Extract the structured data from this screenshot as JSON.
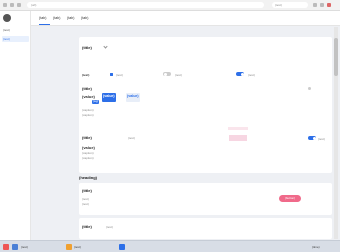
{
  "browser": {
    "url": "(url)",
    "extension_label": "(text)"
  },
  "sidebar": {
    "items": [
      {
        "label": "(text)"
      },
      {
        "label": "(text)"
      }
    ]
  },
  "topnav": {
    "tabs": [
      {
        "label": "(tab)"
      },
      {
        "label": "(tab)"
      },
      {
        "label": "(tab)"
      },
      {
        "label": "(tab)"
      }
    ]
  },
  "account": {
    "title": "(title)"
  },
  "toggles_row": {
    "label": "(text)",
    "option1": "(text)",
    "option2": "(text)",
    "option3": "(text)"
  },
  "stats": {
    "title": "(title)",
    "value1": "(value)",
    "tag": "(tag)",
    "value2": "(value)",
    "value3": "(value)",
    "caption": "(caption)",
    "sub_caption": "(caption)"
  },
  "share": {
    "title": "(title)",
    "note": "(text)",
    "toggle_label": "(text)",
    "percent": "(value)",
    "caption": "(caption)",
    "sub_caption": "(caption)"
  },
  "section_heading": "(heading)",
  "invite": {
    "title": "(title)",
    "desc1": "(text)",
    "desc2": "(text)",
    "button": "(button)"
  },
  "bottom": {
    "title": "(title)",
    "desc": "(text)"
  },
  "taskbar": {
    "items": [
      {
        "label": "(text)"
      },
      {
        "label": "(text)"
      }
    ],
    "clock": "(time)"
  },
  "colors": {
    "accent": "#2d6fe8",
    "pink": "#f06a8a",
    "background": "#eef0f4"
  }
}
